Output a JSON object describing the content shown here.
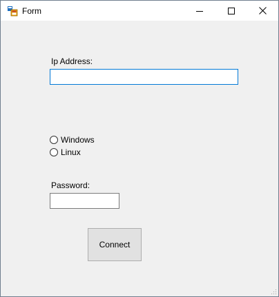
{
  "window": {
    "title": "Form",
    "icon": "winforms-app-icon",
    "controls": {
      "minimize_icon": "minimize-icon",
      "maximize_icon": "maximize-icon",
      "close_icon": "close-icon"
    }
  },
  "form": {
    "ip_label": "Ip Address:",
    "ip_value": "",
    "os_options": [
      {
        "label": "Windows",
        "checked": false
      },
      {
        "label": "Linux",
        "checked": false
      }
    ],
    "password_label": "Password:",
    "password_value": "",
    "connect_label": "Connect"
  },
  "colors": {
    "titlebar_bg": "#ffffff",
    "client_bg": "#f0f0f0",
    "focus_border": "#0078d7",
    "button_bg": "#e1e1e1"
  }
}
